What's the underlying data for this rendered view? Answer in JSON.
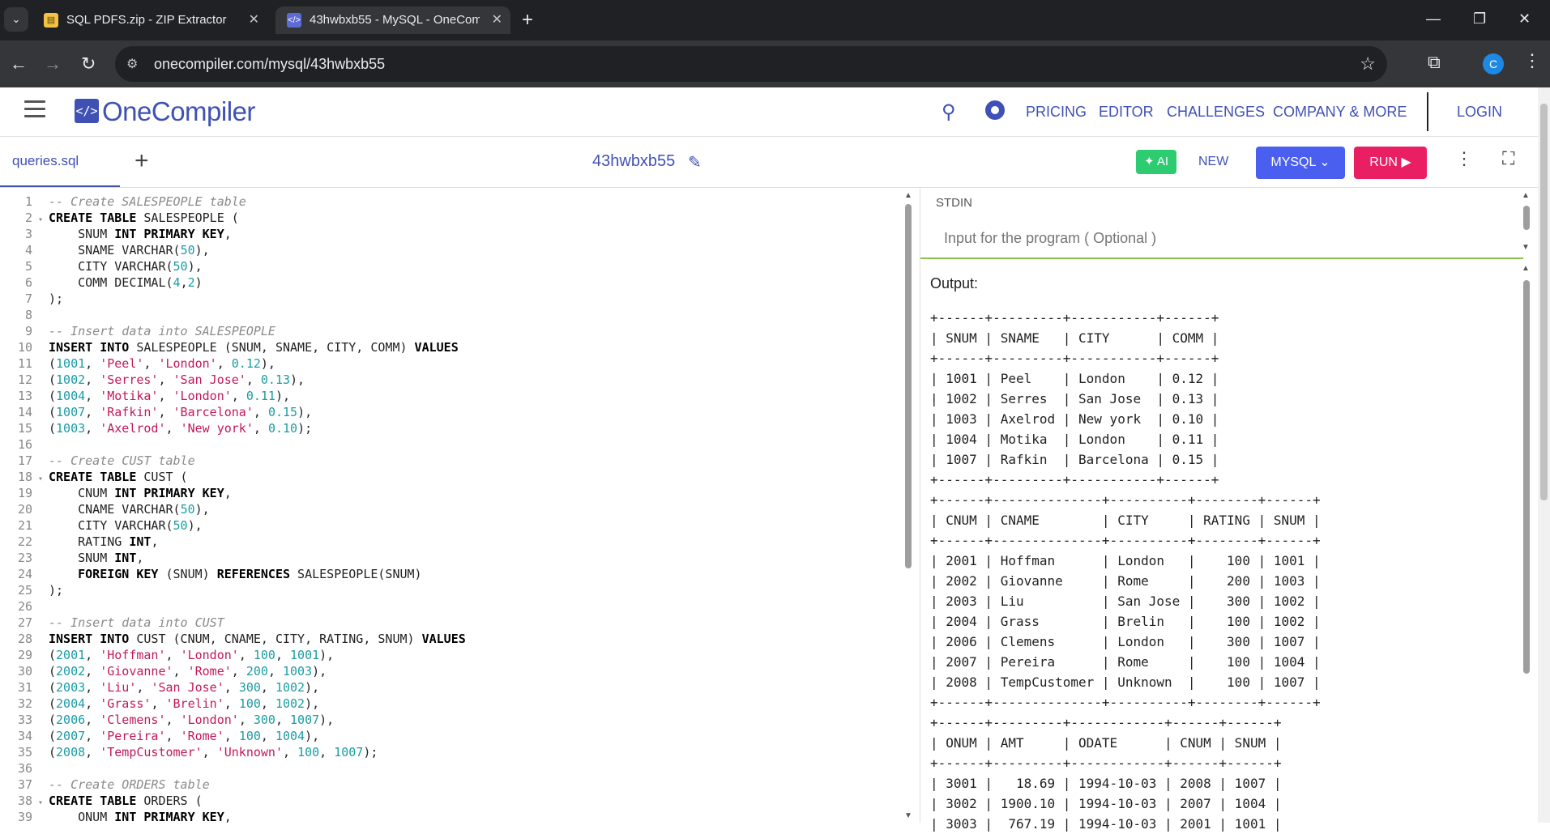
{
  "browser": {
    "tabs": [
      {
        "title": "SQL PDFS.zip - ZIP Extractor",
        "favicon": "zip-icon",
        "active": false
      },
      {
        "title": "43hwbxb55 - MySQL - OneCom",
        "favicon": "code-icon",
        "active": true
      }
    ],
    "url": "onecompiler.com/mysql/43hwbxb55",
    "profile_initial": "C"
  },
  "header": {
    "logo_mark": "</>",
    "logo_text": "OneCompiler",
    "nav": [
      "PRICING",
      "EDITOR",
      "CHALLENGES",
      "COMPANY & MORE"
    ],
    "login": "LOGIN"
  },
  "workspace": {
    "file_tab": "queries.sql",
    "project_name": "43hwbxb55",
    "ai_label": "AI",
    "new_label": "NEW",
    "language": "MYSQL",
    "run_label": "RUN"
  },
  "editor": {
    "lines": [
      {
        "n": 1,
        "fold": false,
        "tokens": [
          [
            "cm",
            "-- Create SALESPEOPLE table"
          ]
        ]
      },
      {
        "n": 2,
        "fold": true,
        "tokens": [
          [
            "kw",
            "CREATE TABLE"
          ],
          [
            "tx",
            " SALESPEOPLE ("
          ]
        ]
      },
      {
        "n": 3,
        "fold": false,
        "tokens": [
          [
            "tx",
            "    SNUM "
          ],
          [
            "kw",
            "INT PRIMARY KEY"
          ],
          [
            "tx",
            ","
          ]
        ]
      },
      {
        "n": 4,
        "fold": false,
        "tokens": [
          [
            "tx",
            "    SNAME VARCHAR("
          ],
          [
            "nm",
            "50"
          ],
          [
            "tx",
            "),"
          ]
        ]
      },
      {
        "n": 5,
        "fold": false,
        "tokens": [
          [
            "tx",
            "    CITY VARCHAR("
          ],
          [
            "nm",
            "50"
          ],
          [
            "tx",
            "),"
          ]
        ]
      },
      {
        "n": 6,
        "fold": false,
        "tokens": [
          [
            "tx",
            "    COMM DECIMAL("
          ],
          [
            "nm",
            "4"
          ],
          [
            "tx",
            ","
          ],
          [
            "nm",
            "2"
          ],
          [
            "tx",
            ")"
          ]
        ]
      },
      {
        "n": 7,
        "fold": false,
        "tokens": [
          [
            "tx",
            ");"
          ]
        ]
      },
      {
        "n": 8,
        "fold": false,
        "tokens": []
      },
      {
        "n": 9,
        "fold": false,
        "tokens": [
          [
            "cm",
            "-- Insert data into SALESPEOPLE"
          ]
        ]
      },
      {
        "n": 10,
        "fold": false,
        "tokens": [
          [
            "kw",
            "INSERT INTO"
          ],
          [
            "tx",
            " SALESPEOPLE (SNUM, SNAME, CITY, COMM) "
          ],
          [
            "kw",
            "VALUES"
          ]
        ]
      },
      {
        "n": 11,
        "fold": false,
        "tokens": [
          [
            "tx",
            "("
          ],
          [
            "nm",
            "1001"
          ],
          [
            "tx",
            ", "
          ],
          [
            "st",
            "'Peel'"
          ],
          [
            "tx",
            ", "
          ],
          [
            "st",
            "'London'"
          ],
          [
            "tx",
            ", "
          ],
          [
            "nm",
            "0.12"
          ],
          [
            "tx",
            "),"
          ]
        ]
      },
      {
        "n": 12,
        "fold": false,
        "tokens": [
          [
            "tx",
            "("
          ],
          [
            "nm",
            "1002"
          ],
          [
            "tx",
            ", "
          ],
          [
            "st",
            "'Serres'"
          ],
          [
            "tx",
            ", "
          ],
          [
            "st",
            "'San Jose'"
          ],
          [
            "tx",
            ", "
          ],
          [
            "nm",
            "0.13"
          ],
          [
            "tx",
            "),"
          ]
        ]
      },
      {
        "n": 13,
        "fold": false,
        "tokens": [
          [
            "tx",
            "("
          ],
          [
            "nm",
            "1004"
          ],
          [
            "tx",
            ", "
          ],
          [
            "st",
            "'Motika'"
          ],
          [
            "tx",
            ", "
          ],
          [
            "st",
            "'London'"
          ],
          [
            "tx",
            ", "
          ],
          [
            "nm",
            "0.11"
          ],
          [
            "tx",
            "),"
          ]
        ]
      },
      {
        "n": 14,
        "fold": false,
        "tokens": [
          [
            "tx",
            "("
          ],
          [
            "nm",
            "1007"
          ],
          [
            "tx",
            ", "
          ],
          [
            "st",
            "'Rafkin'"
          ],
          [
            "tx",
            ", "
          ],
          [
            "st",
            "'Barcelona'"
          ],
          [
            "tx",
            ", "
          ],
          [
            "nm",
            "0.15"
          ],
          [
            "tx",
            "),"
          ]
        ]
      },
      {
        "n": 15,
        "fold": false,
        "tokens": [
          [
            "tx",
            "("
          ],
          [
            "nm",
            "1003"
          ],
          [
            "tx",
            ", "
          ],
          [
            "st",
            "'Axelrod'"
          ],
          [
            "tx",
            ", "
          ],
          [
            "st",
            "'New york'"
          ],
          [
            "tx",
            ", "
          ],
          [
            "nm",
            "0.10"
          ],
          [
            "tx",
            ");"
          ]
        ]
      },
      {
        "n": 16,
        "fold": false,
        "tokens": []
      },
      {
        "n": 17,
        "fold": false,
        "tokens": [
          [
            "cm",
            "-- Create CUST table"
          ]
        ]
      },
      {
        "n": 18,
        "fold": true,
        "tokens": [
          [
            "kw",
            "CREATE TABLE"
          ],
          [
            "tx",
            " CUST ("
          ]
        ]
      },
      {
        "n": 19,
        "fold": false,
        "tokens": [
          [
            "tx",
            "    CNUM "
          ],
          [
            "kw",
            "INT PRIMARY KEY"
          ],
          [
            "tx",
            ","
          ]
        ]
      },
      {
        "n": 20,
        "fold": false,
        "tokens": [
          [
            "tx",
            "    CNAME VARCHAR("
          ],
          [
            "nm",
            "50"
          ],
          [
            "tx",
            "),"
          ]
        ]
      },
      {
        "n": 21,
        "fold": false,
        "tokens": [
          [
            "tx",
            "    CITY VARCHAR("
          ],
          [
            "nm",
            "50"
          ],
          [
            "tx",
            "),"
          ]
        ]
      },
      {
        "n": 22,
        "fold": false,
        "tokens": [
          [
            "tx",
            "    RATING "
          ],
          [
            "kw",
            "INT"
          ],
          [
            "tx",
            ","
          ]
        ]
      },
      {
        "n": 23,
        "fold": false,
        "tokens": [
          [
            "tx",
            "    SNUM "
          ],
          [
            "kw",
            "INT"
          ],
          [
            "tx",
            ","
          ]
        ]
      },
      {
        "n": 24,
        "fold": false,
        "tokens": [
          [
            "tx",
            "    "
          ],
          [
            "kw",
            "FOREIGN KEY"
          ],
          [
            "tx",
            " (SNUM) "
          ],
          [
            "kw",
            "REFERENCES"
          ],
          [
            "tx",
            " SALESPEOPLE(SNUM)"
          ]
        ]
      },
      {
        "n": 25,
        "fold": false,
        "tokens": [
          [
            "tx",
            ");"
          ]
        ]
      },
      {
        "n": 26,
        "fold": false,
        "tokens": []
      },
      {
        "n": 27,
        "fold": false,
        "tokens": [
          [
            "cm",
            "-- Insert data into CUST"
          ]
        ]
      },
      {
        "n": 28,
        "fold": false,
        "tokens": [
          [
            "kw",
            "INSERT INTO"
          ],
          [
            "tx",
            " CUST (CNUM, CNAME, CITY, RATING, SNUM) "
          ],
          [
            "kw",
            "VALUES"
          ]
        ]
      },
      {
        "n": 29,
        "fold": false,
        "tokens": [
          [
            "tx",
            "("
          ],
          [
            "nm",
            "2001"
          ],
          [
            "tx",
            ", "
          ],
          [
            "st",
            "'Hoffman'"
          ],
          [
            "tx",
            ", "
          ],
          [
            "st",
            "'London'"
          ],
          [
            "tx",
            ", "
          ],
          [
            "nm",
            "100"
          ],
          [
            "tx",
            ", "
          ],
          [
            "nm",
            "1001"
          ],
          [
            "tx",
            "),"
          ]
        ]
      },
      {
        "n": 30,
        "fold": false,
        "tokens": [
          [
            "tx",
            "("
          ],
          [
            "nm",
            "2002"
          ],
          [
            "tx",
            ", "
          ],
          [
            "st",
            "'Giovanne'"
          ],
          [
            "tx",
            ", "
          ],
          [
            "st",
            "'Rome'"
          ],
          [
            "tx",
            ", "
          ],
          [
            "nm",
            "200"
          ],
          [
            "tx",
            ", "
          ],
          [
            "nm",
            "1003"
          ],
          [
            "tx",
            "),"
          ]
        ]
      },
      {
        "n": 31,
        "fold": false,
        "tokens": [
          [
            "tx",
            "("
          ],
          [
            "nm",
            "2003"
          ],
          [
            "tx",
            ", "
          ],
          [
            "st",
            "'Liu'"
          ],
          [
            "tx",
            ", "
          ],
          [
            "st",
            "'San Jose'"
          ],
          [
            "tx",
            ", "
          ],
          [
            "nm",
            "300"
          ],
          [
            "tx",
            ", "
          ],
          [
            "nm",
            "1002"
          ],
          [
            "tx",
            "),"
          ]
        ]
      },
      {
        "n": 32,
        "fold": false,
        "tokens": [
          [
            "tx",
            "("
          ],
          [
            "nm",
            "2004"
          ],
          [
            "tx",
            ", "
          ],
          [
            "st",
            "'Grass'"
          ],
          [
            "tx",
            ", "
          ],
          [
            "st",
            "'Brelin'"
          ],
          [
            "tx",
            ", "
          ],
          [
            "nm",
            "100"
          ],
          [
            "tx",
            ", "
          ],
          [
            "nm",
            "1002"
          ],
          [
            "tx",
            "),"
          ]
        ]
      },
      {
        "n": 33,
        "fold": false,
        "tokens": [
          [
            "tx",
            "("
          ],
          [
            "nm",
            "2006"
          ],
          [
            "tx",
            ", "
          ],
          [
            "st",
            "'Clemens'"
          ],
          [
            "tx",
            ", "
          ],
          [
            "st",
            "'London'"
          ],
          [
            "tx",
            ", "
          ],
          [
            "nm",
            "300"
          ],
          [
            "tx",
            ", "
          ],
          [
            "nm",
            "1007"
          ],
          [
            "tx",
            "),"
          ]
        ]
      },
      {
        "n": 34,
        "fold": false,
        "tokens": [
          [
            "tx",
            "("
          ],
          [
            "nm",
            "2007"
          ],
          [
            "tx",
            ", "
          ],
          [
            "st",
            "'Pereira'"
          ],
          [
            "tx",
            ", "
          ],
          [
            "st",
            "'Rome'"
          ],
          [
            "tx",
            ", "
          ],
          [
            "nm",
            "100"
          ],
          [
            "tx",
            ", "
          ],
          [
            "nm",
            "1004"
          ],
          [
            "tx",
            "),"
          ]
        ]
      },
      {
        "n": 35,
        "fold": false,
        "tokens": [
          [
            "tx",
            "("
          ],
          [
            "nm",
            "2008"
          ],
          [
            "tx",
            ", "
          ],
          [
            "st",
            "'TempCustomer'"
          ],
          [
            "tx",
            ", "
          ],
          [
            "st",
            "'Unknown'"
          ],
          [
            "tx",
            ", "
          ],
          [
            "nm",
            "100"
          ],
          [
            "tx",
            ", "
          ],
          [
            "nm",
            "1007"
          ],
          [
            "tx",
            ");"
          ]
        ]
      },
      {
        "n": 36,
        "fold": false,
        "tokens": []
      },
      {
        "n": 37,
        "fold": false,
        "tokens": [
          [
            "cm",
            "-- Create ORDERS table"
          ]
        ]
      },
      {
        "n": 38,
        "fold": true,
        "tokens": [
          [
            "kw",
            "CREATE TABLE"
          ],
          [
            "tx",
            " ORDERS ("
          ]
        ]
      },
      {
        "n": 39,
        "fold": false,
        "tokens": [
          [
            "tx",
            "    ONUM "
          ],
          [
            "kw",
            "INT PRIMARY KEY"
          ],
          [
            "tx",
            ","
          ]
        ]
      }
    ]
  },
  "stdin": {
    "label": "STDIN",
    "placeholder": "Input for the program ( Optional )"
  },
  "output": {
    "label": "Output:",
    "text": "+------+---------+-----------+------+\n| SNUM | SNAME   | CITY      | COMM |\n+------+---------+-----------+------+\n| 1001 | Peel    | London    | 0.12 |\n| 1002 | Serres  | San Jose  | 0.13 |\n| 1003 | Axelrod | New york  | 0.10 |\n| 1004 | Motika  | London    | 0.11 |\n| 1007 | Rafkin  | Barcelona | 0.15 |\n+------+---------+-----------+------+\n+------+--------------+----------+--------+------+\n| CNUM | CNAME        | CITY     | RATING | SNUM |\n+------+--------------+----------+--------+------+\n| 2001 | Hoffman      | London   |    100 | 1001 |\n| 2002 | Giovanne     | Rome     |    200 | 1003 |\n| 2003 | Liu          | San Jose |    300 | 1002 |\n| 2004 | Grass        | Brelin   |    100 | 1002 |\n| 2006 | Clemens      | London   |    300 | 1007 |\n| 2007 | Pereira      | Rome     |    100 | 1004 |\n| 2008 | TempCustomer | Unknown  |    100 | 1007 |\n+------+--------------+----------+--------+------+\n+------+---------+------------+------+------+\n| ONUM | AMT     | ODATE      | CNUM | SNUM |\n+------+---------+------------+------+------+\n| 3001 |   18.69 | 1994-10-03 | 2008 | 1007 |\n| 3002 | 1900.10 | 1994-10-03 | 2007 | 1004 |\n| 3003 |  767.19 | 1994-10-03 | 2001 | 1001 |"
  }
}
